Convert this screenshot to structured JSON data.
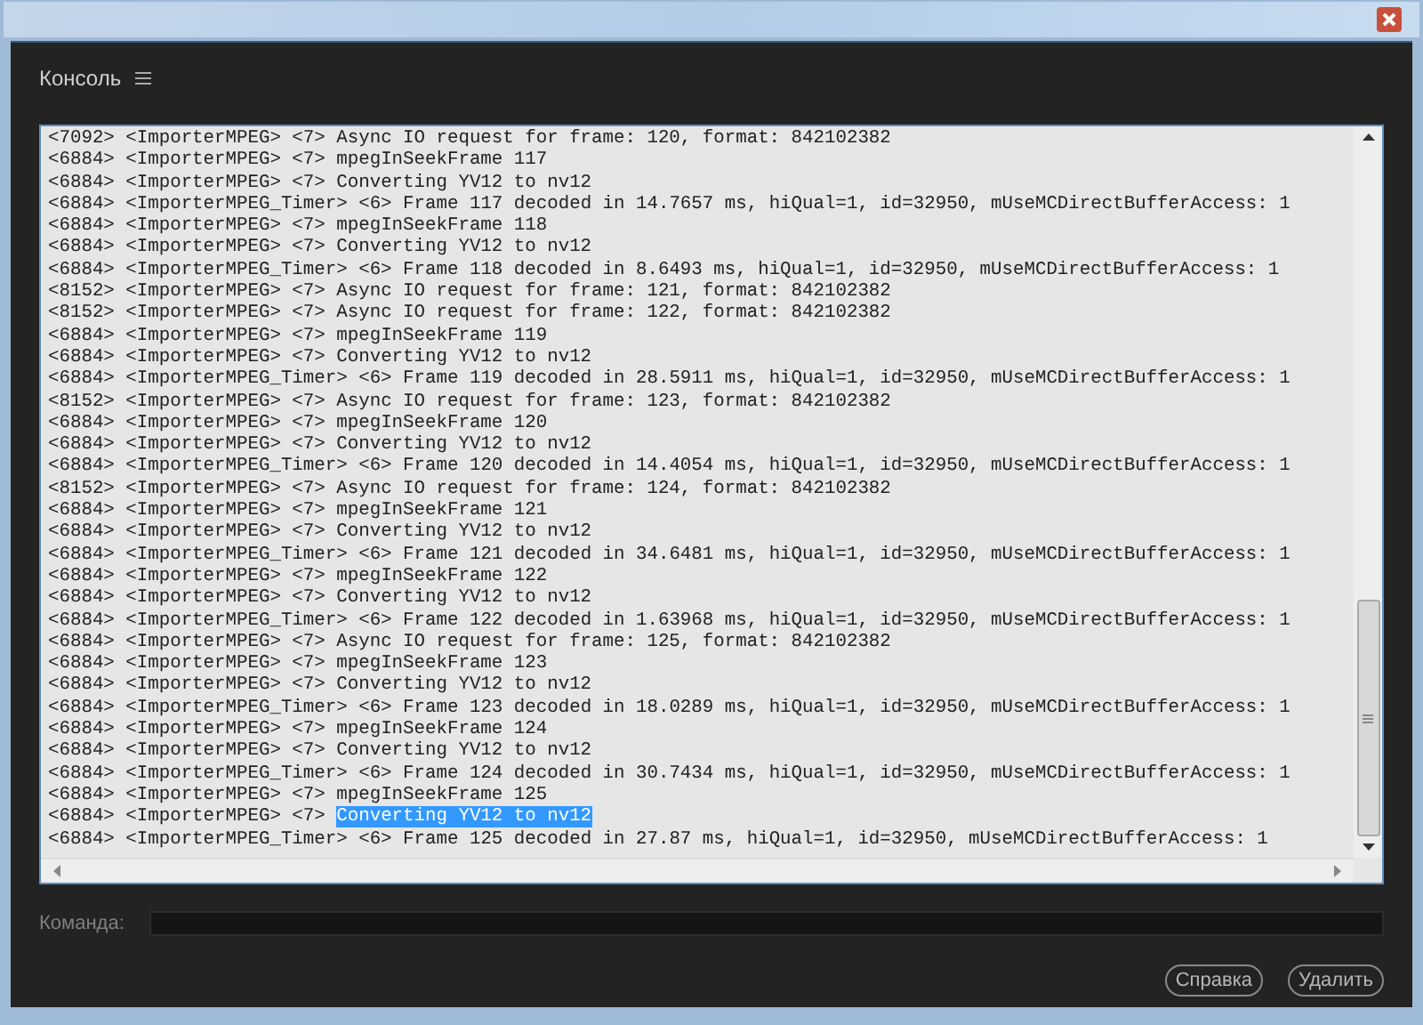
{
  "panel": {
    "title": "Консоль"
  },
  "log": {
    "lines": [
      {
        "prefix": "<7092> <ImporterMPEG> <7>",
        "message": "Async IO request for frame: 120, format: 842102382",
        "selected": false
      },
      {
        "prefix": "<6884> <ImporterMPEG> <7>",
        "message": "mpegInSeekFrame 117",
        "selected": false
      },
      {
        "prefix": "<6884> <ImporterMPEG> <7>",
        "message": "Converting YV12 to nv12",
        "selected": false
      },
      {
        "prefix": "<6884> <ImporterMPEG_Timer> <6>",
        "message": "Frame 117 decoded in 14.7657 ms, hiQual=1, id=32950, mUseMCDirectBufferAccess: 1",
        "selected": false
      },
      {
        "prefix": "<6884> <ImporterMPEG> <7>",
        "message": "mpegInSeekFrame 118",
        "selected": false
      },
      {
        "prefix": "<6884> <ImporterMPEG> <7>",
        "message": "Converting YV12 to nv12",
        "selected": false
      },
      {
        "prefix": "<6884> <ImporterMPEG_Timer> <6>",
        "message": "Frame 118 decoded in 8.6493 ms, hiQual=1, id=32950, mUseMCDirectBufferAccess: 1",
        "selected": false
      },
      {
        "prefix": "<8152> <ImporterMPEG> <7>",
        "message": "Async IO request for frame: 121, format: 842102382",
        "selected": false
      },
      {
        "prefix": "<8152> <ImporterMPEG> <7>",
        "message": "Async IO request for frame: 122, format: 842102382",
        "selected": false
      },
      {
        "prefix": "<6884> <ImporterMPEG> <7>",
        "message": "mpegInSeekFrame 119",
        "selected": false
      },
      {
        "prefix": "<6884> <ImporterMPEG> <7>",
        "message": "Converting YV12 to nv12",
        "selected": false
      },
      {
        "prefix": "<6884> <ImporterMPEG_Timer> <6>",
        "message": "Frame 119 decoded in 28.5911 ms, hiQual=1, id=32950, mUseMCDirectBufferAccess: 1",
        "selected": false
      },
      {
        "prefix": "<8152> <ImporterMPEG> <7>",
        "message": "Async IO request for frame: 123, format: 842102382",
        "selected": false
      },
      {
        "prefix": "<6884> <ImporterMPEG> <7>",
        "message": "mpegInSeekFrame 120",
        "selected": false
      },
      {
        "prefix": "<6884> <ImporterMPEG> <7>",
        "message": "Converting YV12 to nv12",
        "selected": false
      },
      {
        "prefix": "<6884> <ImporterMPEG_Timer> <6>",
        "message": "Frame 120 decoded in 14.4054 ms, hiQual=1, id=32950, mUseMCDirectBufferAccess: 1",
        "selected": false
      },
      {
        "prefix": "<8152> <ImporterMPEG> <7>",
        "message": "Async IO request for frame: 124, format: 842102382",
        "selected": false
      },
      {
        "prefix": "<6884> <ImporterMPEG> <7>",
        "message": "mpegInSeekFrame 121",
        "selected": false
      },
      {
        "prefix": "<6884> <ImporterMPEG> <7>",
        "message": "Converting YV12 to nv12",
        "selected": false
      },
      {
        "prefix": "<6884> <ImporterMPEG_Timer> <6>",
        "message": "Frame 121 decoded in 34.6481 ms, hiQual=1, id=32950, mUseMCDirectBufferAccess: 1",
        "selected": false
      },
      {
        "prefix": "<6884> <ImporterMPEG> <7>",
        "message": "mpegInSeekFrame 122",
        "selected": false
      },
      {
        "prefix": "<6884> <ImporterMPEG> <7>",
        "message": "Converting YV12 to nv12",
        "selected": false
      },
      {
        "prefix": "<6884> <ImporterMPEG_Timer> <6>",
        "message": "Frame 122 decoded in 1.63968 ms, hiQual=1, id=32950, mUseMCDirectBufferAccess: 1",
        "selected": false
      },
      {
        "prefix": "<6884> <ImporterMPEG> <7>",
        "message": "Async IO request for frame: 125, format: 842102382",
        "selected": false
      },
      {
        "prefix": "<6884> <ImporterMPEG> <7>",
        "message": "mpegInSeekFrame 123",
        "selected": false
      },
      {
        "prefix": "<6884> <ImporterMPEG> <7>",
        "message": "Converting YV12 to nv12",
        "selected": false
      },
      {
        "prefix": "<6884> <ImporterMPEG_Timer> <6>",
        "message": "Frame 123 decoded in 18.0289 ms, hiQual=1, id=32950, mUseMCDirectBufferAccess: 1",
        "selected": false
      },
      {
        "prefix": "<6884> <ImporterMPEG> <7>",
        "message": "mpegInSeekFrame 124",
        "selected": false
      },
      {
        "prefix": "<6884> <ImporterMPEG> <7>",
        "message": "Converting YV12 to nv12",
        "selected": false
      },
      {
        "prefix": "<6884> <ImporterMPEG_Timer> <6>",
        "message": "Frame 124 decoded in 30.7434 ms, hiQual=1, id=32950, mUseMCDirectBufferAccess: 1",
        "selected": false
      },
      {
        "prefix": "<6884> <ImporterMPEG> <7>",
        "message": "mpegInSeekFrame 125",
        "selected": false
      },
      {
        "prefix": "<6884> <ImporterMPEG> <7>",
        "message": "Converting YV12 to nv12",
        "selected": true
      },
      {
        "prefix": "<6884> <ImporterMPEG_Timer> <6>",
        "message": "Frame 125 decoded in 27.87 ms, hiQual=1, id=32950, mUseMCDirectBufferAccess: 1",
        "selected": false
      }
    ]
  },
  "command": {
    "label": "Команда:"
  },
  "buttons": [
    "Справка",
    "Удалить"
  ]
}
